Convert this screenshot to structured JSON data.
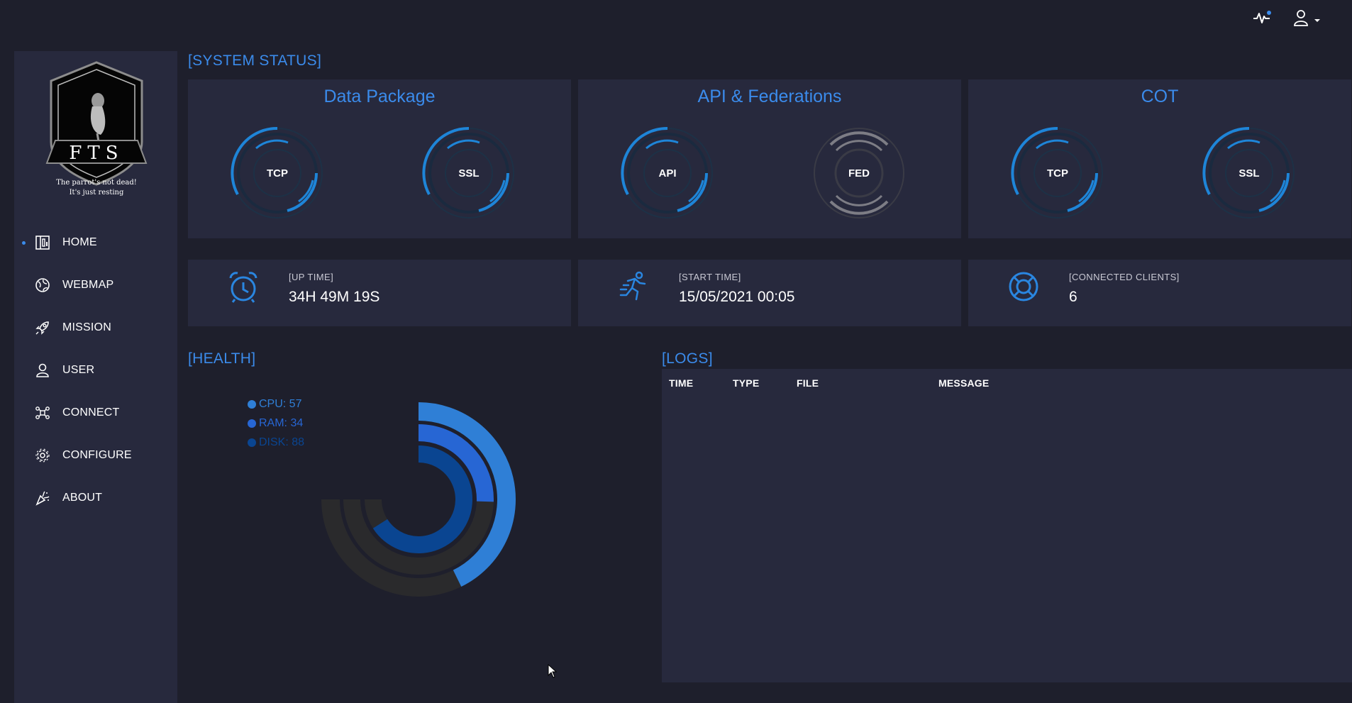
{
  "sidebar": {
    "logo": {
      "text": "FTS",
      "tagline_1": "The parrot's not dead!",
      "tagline_2": "It's just resting"
    },
    "items": [
      {
        "label": "HOME",
        "icon": "dashboard-icon",
        "active": true
      },
      {
        "label": "WEBMAP",
        "icon": "globe-icon"
      },
      {
        "label": "MISSION",
        "icon": "rocket-icon"
      },
      {
        "label": "USER",
        "icon": "user-icon"
      },
      {
        "label": "CONNECT",
        "icon": "network-icon"
      },
      {
        "label": "CONFIGURE",
        "icon": "gear-icon"
      },
      {
        "label": "ABOUT",
        "icon": "party-popper-icon"
      }
    ]
  },
  "topbar": {
    "activity_icon": "activity-pulse-icon",
    "user_icon": "user-icon"
  },
  "system_status": {
    "title": "[SYSTEM STATUS]",
    "cards": [
      {
        "title": "Data Package",
        "gauges": [
          {
            "label": "TCP",
            "active": true
          },
          {
            "label": "SSL",
            "active": true
          }
        ]
      },
      {
        "title": "API & Federations",
        "gauges": [
          {
            "label": "API",
            "active": true
          },
          {
            "label": "FED",
            "active": false
          }
        ]
      },
      {
        "title": "COT",
        "gauges": [
          {
            "label": "TCP",
            "active": true
          },
          {
            "label": "SSL",
            "active": true
          }
        ]
      }
    ]
  },
  "info": [
    {
      "label": "[UP TIME]",
      "value": "34H 49M 19S",
      "icon": "alarm-clock-icon"
    },
    {
      "label": "[START TIME]",
      "value": "15/05/2021 00:05",
      "icon": "running-person-icon"
    },
    {
      "label": "[CONNECTED CLIENTS]",
      "value": "6",
      "icon": "lifebuoy-icon"
    }
  ],
  "health": {
    "title": "[HEALTH]",
    "legend": [
      {
        "label": "CPU: 57",
        "color": "#2f7fd6"
      },
      {
        "label": "RAM: 34",
        "color": "#2766d4"
      },
      {
        "label": "DISK: 88",
        "color": "#0a4591"
      }
    ],
    "chart_data": {
      "type": "radial-bar",
      "series": [
        {
          "name": "CPU",
          "value": 57,
          "color": "#2f7fd6"
        },
        {
          "name": "RAM",
          "value": 34,
          "color": "#2766d4"
        },
        {
          "name": "DISK",
          "value": 88,
          "color": "#0a4591"
        }
      ],
      "max": 100
    }
  },
  "logs": {
    "title": "[LOGS]",
    "columns": [
      "TIME",
      "TYPE",
      "FILE",
      "MESSAGE"
    ]
  },
  "colors": {
    "accent": "#3b8beb",
    "background": "#1e1f2c",
    "card": "#27293d"
  }
}
